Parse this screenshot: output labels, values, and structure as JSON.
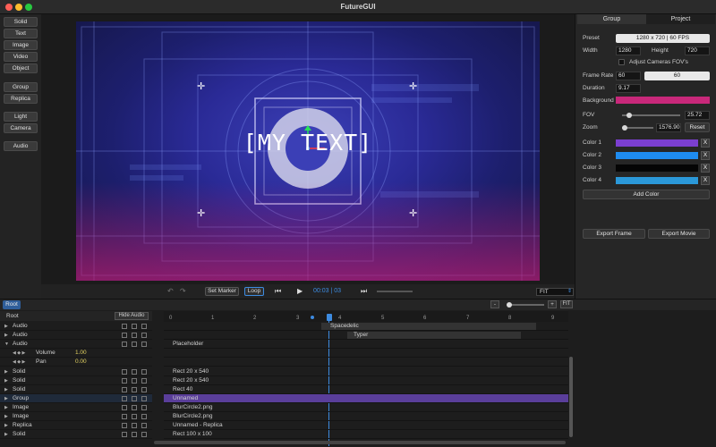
{
  "window": {
    "title": "FutureGUI"
  },
  "tools": [
    "Solid",
    "Text",
    "Image",
    "Video",
    "Object",
    "Group",
    "Replica",
    "Light",
    "Camera",
    "Audio"
  ],
  "canvas": {
    "text": "[MY TEXT]"
  },
  "playbar": {
    "set_marker": "Set Marker",
    "loop": "Loop",
    "time": "00:03 | 03",
    "zoom_select": "FIT"
  },
  "panel": {
    "tabs": [
      "Group",
      "Project"
    ],
    "preset_label": "Preset",
    "preset_value": "1280 x 720 | 60 FPS",
    "width_label": "Width",
    "width_value": "1280",
    "height_label": "Height",
    "height_value": "720",
    "adjust_fov_label": "Adjust Cameras FOV's",
    "frame_rate_label": "Frame Rate",
    "frame_rate_value": "60",
    "frame_rate_select": "60",
    "duration_label": "Duration",
    "duration_value": "9.17",
    "background_label": "Background",
    "background_color": "#c8287a",
    "fov_label": "FOV",
    "fov_value": "25.72",
    "fov_level": 0.12,
    "zoom_label": "Zoom",
    "zoom_value": "1576.90",
    "zoom_level": 0.08,
    "reset_label": "Reset",
    "colors": [
      {
        "label": "Color 1",
        "color": "#7b3fd0"
      },
      {
        "label": "Color 2",
        "color": "#1e8cf0"
      },
      {
        "label": "Color 3",
        "color": "#050505"
      },
      {
        "label": "Color 4",
        "color": "#2b98d8"
      }
    ],
    "remove_label": "X",
    "add_color_label": "Add Color",
    "export_frame_label": "Export Frame",
    "export_movie_label": "Export Movie"
  },
  "timeline": {
    "root_tab": "Root",
    "root_label": "Root",
    "hide_audio_label": "Hide Audio",
    "minus_label": "-",
    "plus_label": "+",
    "fit_label": "FIT",
    "ruler": [
      "0",
      "1",
      "2",
      "3",
      "4",
      "5",
      "6",
      "7",
      "8",
      "9"
    ],
    "rows": [
      {
        "name": "Audio",
        "track": "Spacedelic"
      },
      {
        "name": "Audio",
        "track": "Typer"
      },
      {
        "name": "Audio",
        "track": "Placeholder"
      },
      {
        "name": "Volume",
        "value": "1.00"
      },
      {
        "name": "Pan",
        "value": "0.00"
      },
      {
        "name": "Solid",
        "track": "Rect 20 x 540"
      },
      {
        "name": "Solid",
        "track": "Rect 20 x 540"
      },
      {
        "name": "Solid",
        "track": "Rect 40"
      },
      {
        "name": "Group",
        "track": "Unnamed"
      },
      {
        "name": "Image",
        "track": "BlurCircle2.png"
      },
      {
        "name": "Image",
        "track": "BlurCircle2.png"
      },
      {
        "name": "Replica",
        "track": "Unnamed - Replica"
      },
      {
        "name": "Solid",
        "track": "Rect 100 x 100"
      }
    ]
  }
}
